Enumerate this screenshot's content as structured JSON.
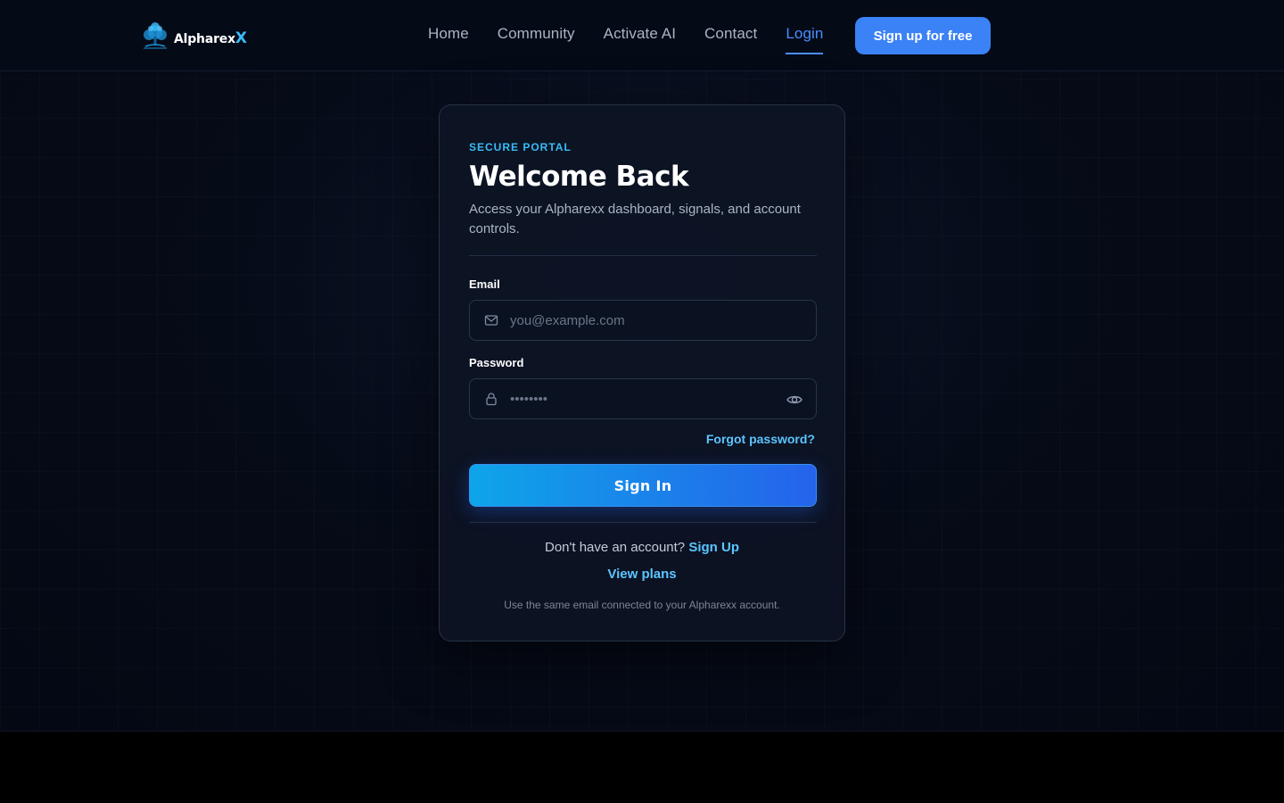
{
  "brand": {
    "name": "Alpharex",
    "mark": "X",
    "logo_alt": "AlpharexX"
  },
  "nav": {
    "items": [
      {
        "label": "Home",
        "active": false
      },
      {
        "label": "Community",
        "active": false
      },
      {
        "label": "Activate AI",
        "active": false
      },
      {
        "label": "Contact",
        "active": false
      },
      {
        "label": "Login",
        "active": true
      }
    ],
    "cta_label": "Sign up for free"
  },
  "login": {
    "eyebrow": "SECURE PORTAL",
    "title": "Welcome Back",
    "subtitle": "Access your Alpharexx dashboard, signals, and account controls.",
    "email": {
      "label": "Email",
      "placeholder": "you@example.com",
      "value": "",
      "icon": "mail-icon"
    },
    "password": {
      "label": "Password",
      "placeholder": "••••••••",
      "value": "",
      "icon": "lock-icon",
      "toggle_icon": "eye-icon"
    },
    "forgot_label": "Forgot password?",
    "submit_label": "Sign In",
    "no_account_text": "Don't have an account?",
    "signup_link": "Sign Up",
    "plans_link": "View plans",
    "note": "Use the same email connected to your Alpharexx account."
  },
  "colors": {
    "accent": "#3b82f6",
    "link": "#5cc5ff",
    "background": "#060b18",
    "card": "#0d1424"
  }
}
